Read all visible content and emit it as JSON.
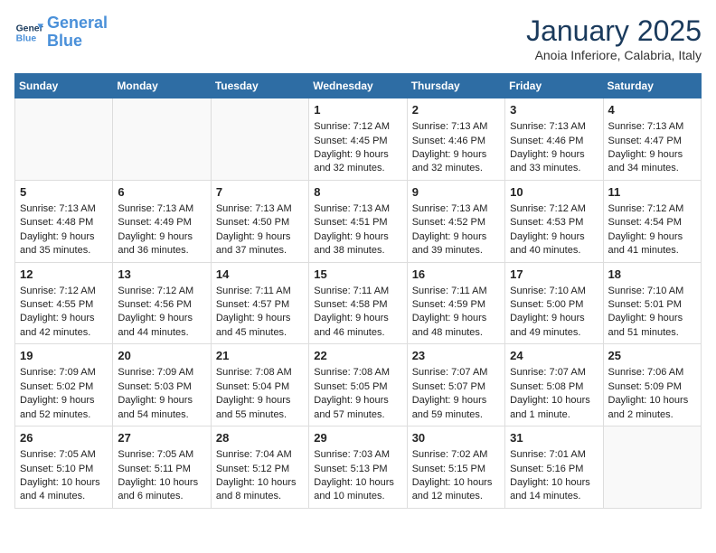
{
  "logo": {
    "line1": "General",
    "line2": "Blue"
  },
  "title": "January 2025",
  "subtitle": "Anoia Inferiore, Calabria, Italy",
  "days_of_week": [
    "Sunday",
    "Monday",
    "Tuesday",
    "Wednesday",
    "Thursday",
    "Friday",
    "Saturday"
  ],
  "weeks": [
    [
      {
        "day": "",
        "info": ""
      },
      {
        "day": "",
        "info": ""
      },
      {
        "day": "",
        "info": ""
      },
      {
        "day": "1",
        "info": "Sunrise: 7:12 AM\nSunset: 4:45 PM\nDaylight: 9 hours and 32 minutes."
      },
      {
        "day": "2",
        "info": "Sunrise: 7:13 AM\nSunset: 4:46 PM\nDaylight: 9 hours and 32 minutes."
      },
      {
        "day": "3",
        "info": "Sunrise: 7:13 AM\nSunset: 4:46 PM\nDaylight: 9 hours and 33 minutes."
      },
      {
        "day": "4",
        "info": "Sunrise: 7:13 AM\nSunset: 4:47 PM\nDaylight: 9 hours and 34 minutes."
      }
    ],
    [
      {
        "day": "5",
        "info": "Sunrise: 7:13 AM\nSunset: 4:48 PM\nDaylight: 9 hours and 35 minutes."
      },
      {
        "day": "6",
        "info": "Sunrise: 7:13 AM\nSunset: 4:49 PM\nDaylight: 9 hours and 36 minutes."
      },
      {
        "day": "7",
        "info": "Sunrise: 7:13 AM\nSunset: 4:50 PM\nDaylight: 9 hours and 37 minutes."
      },
      {
        "day": "8",
        "info": "Sunrise: 7:13 AM\nSunset: 4:51 PM\nDaylight: 9 hours and 38 minutes."
      },
      {
        "day": "9",
        "info": "Sunrise: 7:13 AM\nSunset: 4:52 PM\nDaylight: 9 hours and 39 minutes."
      },
      {
        "day": "10",
        "info": "Sunrise: 7:12 AM\nSunset: 4:53 PM\nDaylight: 9 hours and 40 minutes."
      },
      {
        "day": "11",
        "info": "Sunrise: 7:12 AM\nSunset: 4:54 PM\nDaylight: 9 hours and 41 minutes."
      }
    ],
    [
      {
        "day": "12",
        "info": "Sunrise: 7:12 AM\nSunset: 4:55 PM\nDaylight: 9 hours and 42 minutes."
      },
      {
        "day": "13",
        "info": "Sunrise: 7:12 AM\nSunset: 4:56 PM\nDaylight: 9 hours and 44 minutes."
      },
      {
        "day": "14",
        "info": "Sunrise: 7:11 AM\nSunset: 4:57 PM\nDaylight: 9 hours and 45 minutes."
      },
      {
        "day": "15",
        "info": "Sunrise: 7:11 AM\nSunset: 4:58 PM\nDaylight: 9 hours and 46 minutes."
      },
      {
        "day": "16",
        "info": "Sunrise: 7:11 AM\nSunset: 4:59 PM\nDaylight: 9 hours and 48 minutes."
      },
      {
        "day": "17",
        "info": "Sunrise: 7:10 AM\nSunset: 5:00 PM\nDaylight: 9 hours and 49 minutes."
      },
      {
        "day": "18",
        "info": "Sunrise: 7:10 AM\nSunset: 5:01 PM\nDaylight: 9 hours and 51 minutes."
      }
    ],
    [
      {
        "day": "19",
        "info": "Sunrise: 7:09 AM\nSunset: 5:02 PM\nDaylight: 9 hours and 52 minutes."
      },
      {
        "day": "20",
        "info": "Sunrise: 7:09 AM\nSunset: 5:03 PM\nDaylight: 9 hours and 54 minutes."
      },
      {
        "day": "21",
        "info": "Sunrise: 7:08 AM\nSunset: 5:04 PM\nDaylight: 9 hours and 55 minutes."
      },
      {
        "day": "22",
        "info": "Sunrise: 7:08 AM\nSunset: 5:05 PM\nDaylight: 9 hours and 57 minutes."
      },
      {
        "day": "23",
        "info": "Sunrise: 7:07 AM\nSunset: 5:07 PM\nDaylight: 9 hours and 59 minutes."
      },
      {
        "day": "24",
        "info": "Sunrise: 7:07 AM\nSunset: 5:08 PM\nDaylight: 10 hours and 1 minute."
      },
      {
        "day": "25",
        "info": "Sunrise: 7:06 AM\nSunset: 5:09 PM\nDaylight: 10 hours and 2 minutes."
      }
    ],
    [
      {
        "day": "26",
        "info": "Sunrise: 7:05 AM\nSunset: 5:10 PM\nDaylight: 10 hours and 4 minutes."
      },
      {
        "day": "27",
        "info": "Sunrise: 7:05 AM\nSunset: 5:11 PM\nDaylight: 10 hours and 6 minutes."
      },
      {
        "day": "28",
        "info": "Sunrise: 7:04 AM\nSunset: 5:12 PM\nDaylight: 10 hours and 8 minutes."
      },
      {
        "day": "29",
        "info": "Sunrise: 7:03 AM\nSunset: 5:13 PM\nDaylight: 10 hours and 10 minutes."
      },
      {
        "day": "30",
        "info": "Sunrise: 7:02 AM\nSunset: 5:15 PM\nDaylight: 10 hours and 12 minutes."
      },
      {
        "day": "31",
        "info": "Sunrise: 7:01 AM\nSunset: 5:16 PM\nDaylight: 10 hours and 14 minutes."
      },
      {
        "day": "",
        "info": ""
      }
    ]
  ]
}
